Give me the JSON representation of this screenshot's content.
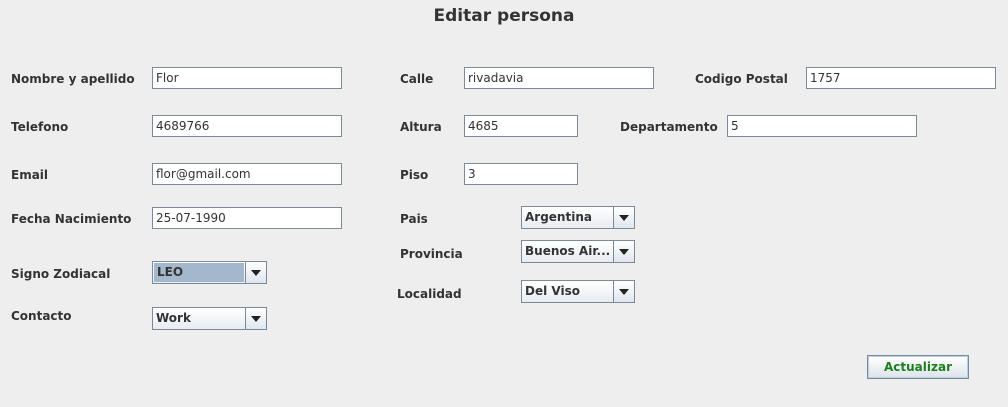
{
  "title": "Editar persona",
  "left": {
    "nombre": {
      "label": "Nombre y apellido",
      "value": "Flor"
    },
    "telefono": {
      "label": "Telefono",
      "value": "4689766"
    },
    "email": {
      "label": "Email",
      "value": "flor@gmail.com"
    },
    "fecha": {
      "label": "Fecha Nacimiento",
      "value": "25-07-1990"
    },
    "signo": {
      "label": "Signo Zodiacal",
      "value": "LEO"
    },
    "contacto": {
      "label": "Contacto",
      "value": "Work"
    }
  },
  "middle": {
    "calle": {
      "label": "Calle",
      "value": "rivadavia"
    },
    "altura": {
      "label": "Altura",
      "value": "4685"
    },
    "piso": {
      "label": "Piso",
      "value": "3"
    },
    "pais": {
      "label": "Pais",
      "value": "Argentina"
    },
    "provincia": {
      "label": "Provincia",
      "value": "Buenos Air..."
    },
    "localidad": {
      "label": "Localidad",
      "value": "Del Viso"
    }
  },
  "right": {
    "codigo_postal": {
      "label": "Codigo Postal",
      "value": "1757"
    },
    "departamento": {
      "label": "Departamento",
      "value": "5"
    }
  },
  "actions": {
    "update_label": "Actualizar"
  },
  "colors": {
    "button_text": "#1d7f1d",
    "selected_combo": "#a3b8cc"
  }
}
